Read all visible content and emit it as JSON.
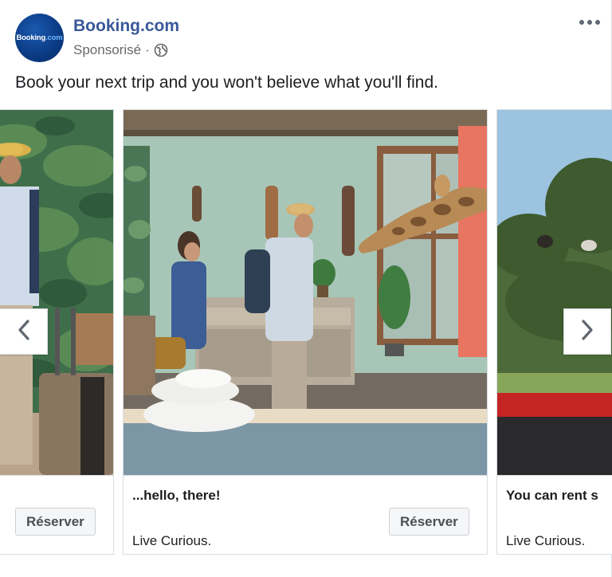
{
  "post": {
    "page_name": "Booking.com",
    "avatar_text": "Booking",
    "avatar_text_suffix": ".com",
    "sponsored_label": "Sponsorisé",
    "separator": "·",
    "message": "Book your next trip and you won't believe what you'll find."
  },
  "icons": {
    "more": "more-options-icon",
    "audience": "globe-icon",
    "prev": "chevron-left-icon",
    "next": "chevron-right-icon"
  },
  "carousel": {
    "cards": [
      {
        "title": "",
        "description": "",
        "cta": "Réserver"
      },
      {
        "title": "...hello, there!",
        "description": "Live Curious.",
        "cta": "Réserver"
      },
      {
        "title": "You can rent s",
        "description": "Live Curious.",
        "cta": ""
      }
    ]
  },
  "colors": {
    "page_name": "#385898",
    "secondary_text": "#65676b",
    "border": "#dadde1",
    "button_bg": "#f5f6f7"
  }
}
